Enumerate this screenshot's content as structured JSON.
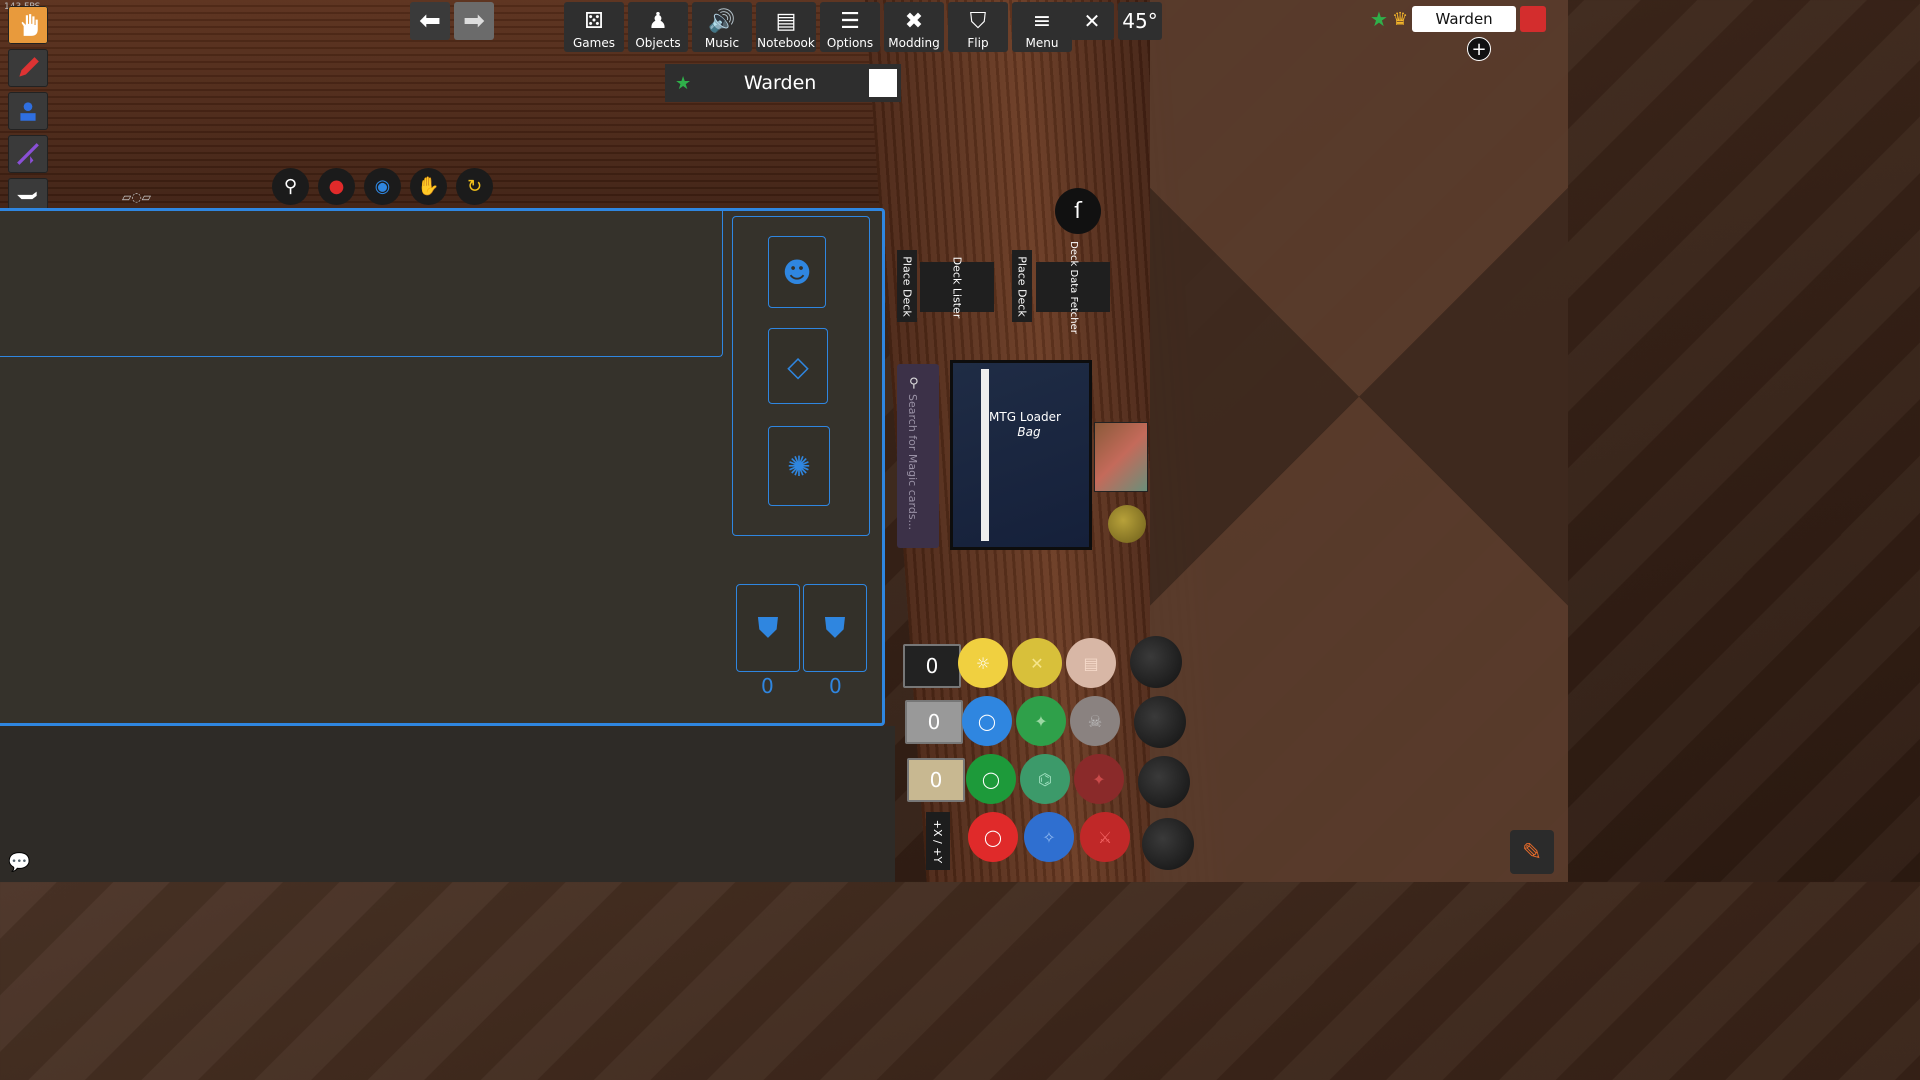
{
  "fps": "143 FPS",
  "menu": {
    "games": "Games",
    "objects": "Objects",
    "music": "Music",
    "notebook": "Notebook",
    "options": "Options",
    "modding": "Modding",
    "flip": "Flip",
    "menu": "Menu"
  },
  "camera": {
    "angle": "45°"
  },
  "player": {
    "name": "Warden",
    "color": "#d32d2d"
  },
  "seat": {
    "name": "Warden"
  },
  "mat": {
    "counter_left": "0",
    "counter_right": "0"
  },
  "deck_tools": {
    "place_deck_1": "Place Deck",
    "deck_lister": "Deck Lister",
    "place_deck_2": "Place Deck",
    "deck_data_fetcher": "Deck Data Fetcher"
  },
  "search": {
    "placeholder": "Search for Magic cards..."
  },
  "bag": {
    "title": "MTG Loader",
    "subtitle": "Bag"
  },
  "tokens": {
    "row1": "0",
    "row2": "0",
    "row3": "0",
    "xy": "+X / +Y"
  },
  "colors": {
    "accent": "#2f86e0",
    "active_tool": "#e89a3c"
  }
}
